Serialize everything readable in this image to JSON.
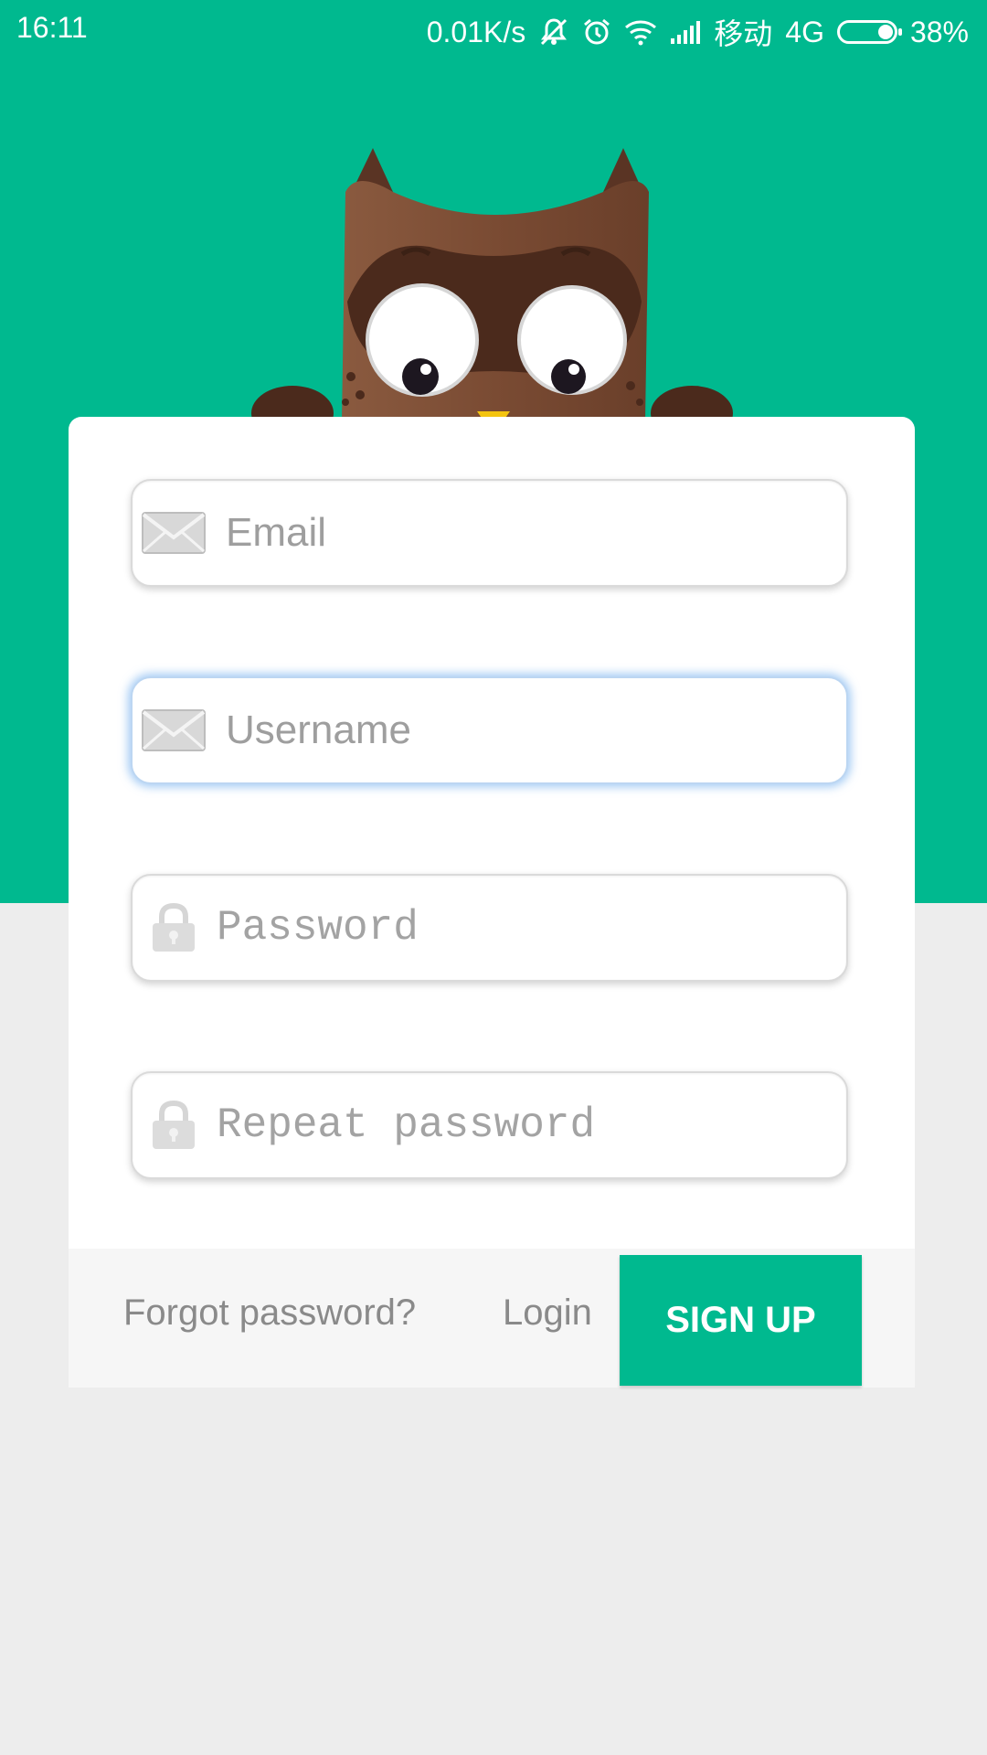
{
  "status_bar": {
    "time": "16:11",
    "net_speed": "0.01K/s",
    "carrier": "移动",
    "network": "4G",
    "battery": "38%",
    "icons": [
      "mute-icon",
      "alarm-icon",
      "wifi-icon",
      "signal-icon",
      "battery-icon"
    ]
  },
  "form": {
    "email_placeholder": "Email",
    "username_placeholder": "Username",
    "password_placeholder": "Password",
    "repeat_password_placeholder": "Repeat password"
  },
  "footer": {
    "forgot_label": "Forgot password?",
    "login_label": "Login",
    "signup_label": "SIGN UP"
  },
  "colors": {
    "accent": "#00b98f",
    "background": "#ededed",
    "owl_body": "#7a4a33"
  }
}
